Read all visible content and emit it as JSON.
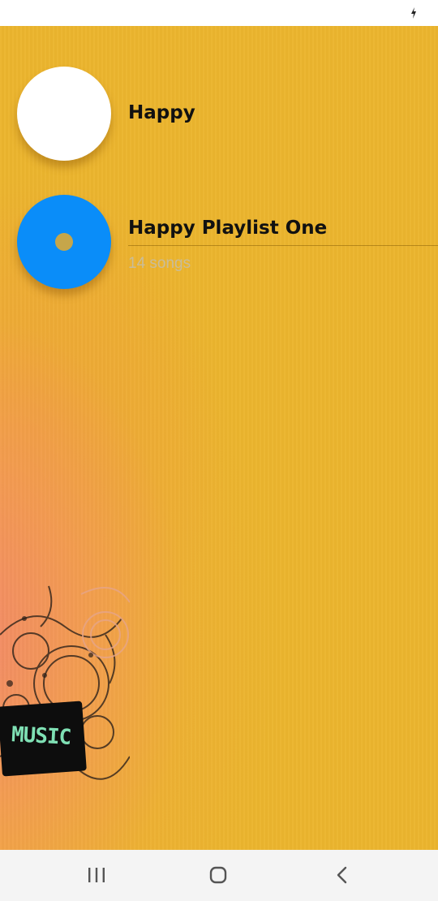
{
  "status_bar": {
    "battery_icon": "battery-charging-icon"
  },
  "list": {
    "items": [
      {
        "title": "Happy",
        "subtitle": "",
        "art_icon": "white-circle-art",
        "art_color": "#ffffff"
      },
      {
        "title": "Happy Playlist One",
        "subtitle": "14 songs",
        "art_icon": "disc-icon",
        "art_color": "#0a8df9"
      }
    ]
  },
  "background": {
    "base_color": "#ecb52e",
    "accent_color": "#f3856e",
    "artwork_text": "MUSIC"
  },
  "nav_bar": {
    "recents_icon": "recents-icon",
    "home_icon": "home-icon",
    "back_icon": "back-icon"
  }
}
